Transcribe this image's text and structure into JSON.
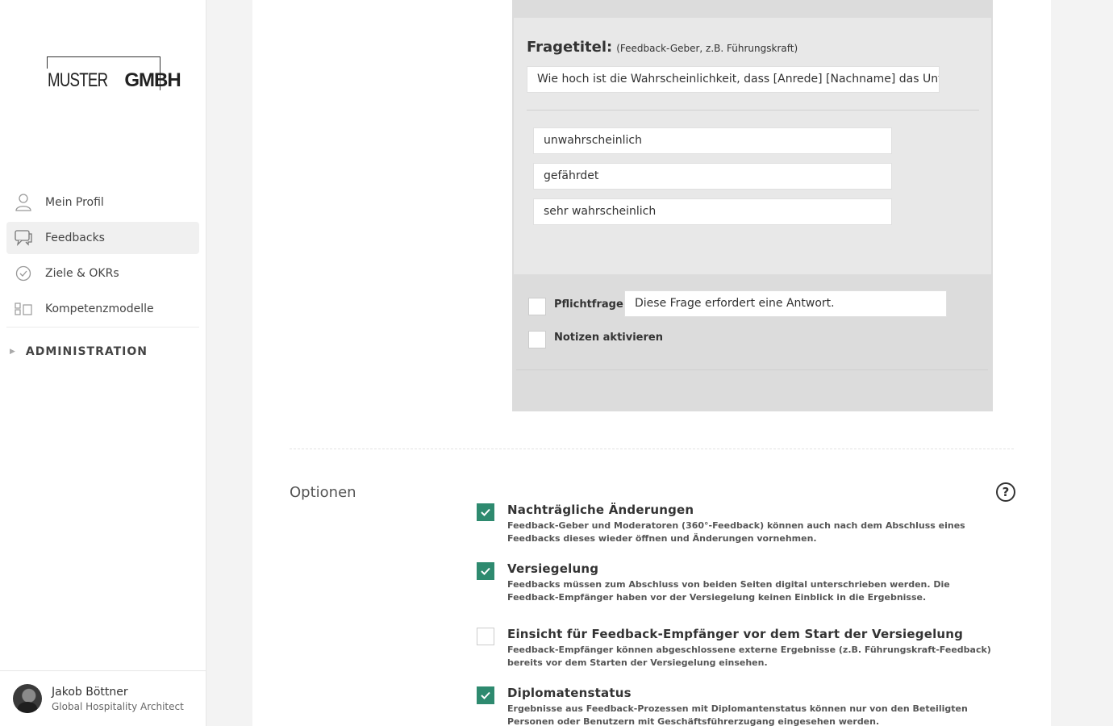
{
  "brand": {
    "logo_thin": "MUSTER",
    "logo_bold": "GMBH"
  },
  "sidebar": {
    "items": [
      {
        "label": "Mein Profil",
        "icon": "user-icon"
      },
      {
        "label": "Feedbacks",
        "icon": "chat-icon",
        "active": true
      },
      {
        "label": "Ziele & OKRs",
        "icon": "check-circle-icon"
      },
      {
        "label": "Kompetenzmodelle",
        "icon": "blocks-icon"
      }
    ],
    "admin_label": "ADMINISTRATION"
  },
  "user": {
    "name": "Jakob Böttner",
    "role": "Global Hospitality Architect"
  },
  "question": {
    "title_label": "Fragetitel:",
    "title_hint": "(Feedback-Geber, z.B. Führungskraft)",
    "title_value": "Wie hoch ist die Wahrscheinlichkeit, dass [Anrede] [Nachname] das Unternehmen verlässt?",
    "answers": [
      "unwahrscheinlich",
      "gefährdet",
      "sehr wahrscheinlich"
    ],
    "required_label": "Pflichtfrage",
    "required_text": "Diese Frage erfordert eine Antwort.",
    "notes_label": "Notizen aktivieren"
  },
  "options": {
    "heading": "Optionen",
    "help_symbol": "?",
    "items": [
      {
        "title": "Nachträgliche Änderungen",
        "desc": "Feedback-Geber und Moderatoren (360°-Feedback) können auch nach dem Abschluss eines Feedbacks dieses wieder öffnen und Änderungen vornehmen.",
        "checked": true
      },
      {
        "title": "Versiegelung",
        "desc": "Feedbacks müssen zum Abschluss von beiden Seiten digital unterschrieben werden. Die Feedback-Empfänger haben vor der Versiegelung keinen Einblick in die Ergebnisse.",
        "checked": true
      },
      {
        "title": "Einsicht für Feedback-Empfänger vor dem Start der Versiegelung",
        "desc": "Feedback-Empfänger können abgeschlossene externe Ergebnisse (z.B. Führungskraft-Feedback) bereits vor dem Starten der Versiegelung einsehen.",
        "checked": false
      },
      {
        "title": "Diplomatenstatus",
        "desc": "Ergebnisse aus Feedback-Prozessen mit Diplomantenstatus können nur von den Beteiligten Personen oder Benutzern mit Geschäftsführerzugang eingesehen werden.",
        "checked": true
      }
    ]
  },
  "colors": {
    "accent": "#2e8a6f"
  }
}
